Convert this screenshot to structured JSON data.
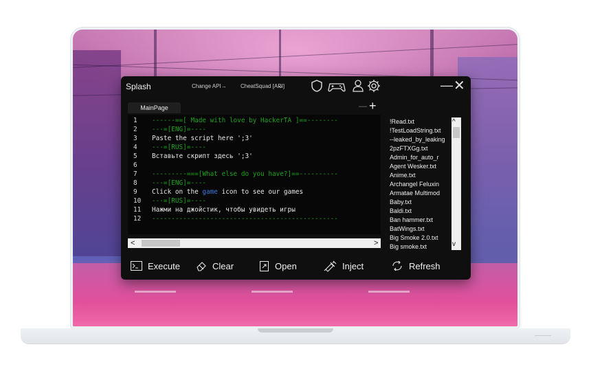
{
  "window": {
    "title": "Splash",
    "change_api_label": "Change API→",
    "api_selected": "CheatSquad [API]",
    "minimize_glyph": "—",
    "close_glyph": "✕"
  },
  "editor": {
    "tab_label": "MainPage",
    "tab_minimize_glyph": "—",
    "tab_add_glyph": "+",
    "lines": [
      {
        "n": "1",
        "text": "------==[ Made with love by HackerTA ]==--------"
      },
      {
        "n": "2",
        "text": "---=[ENG]=----"
      },
      {
        "n": "3",
        "text": "Paste the script here ';3'"
      },
      {
        "n": "4",
        "text": "---=[RUS]=----"
      },
      {
        "n": "5",
        "text": "Вставьте скрипт здесь ';3'"
      },
      {
        "n": "6",
        "text": ""
      },
      {
        "n": "7",
        "text": "---------===[What else do you have?]==----------"
      },
      {
        "n": "8",
        "text": "---=[ENG]=----"
      },
      {
        "n": "9",
        "text_before": "Click on the ",
        "text_highlight": "game",
        "text_after": " icon to see our games"
      },
      {
        "n": "10",
        "text": "---=[RUS]=----"
      },
      {
        "n": "11",
        "text": "Нажми на джойстик, чтобы увидеть игры"
      },
      {
        "n": "12",
        "text": "------------------------------------------------"
      }
    ],
    "scroll_left_glyph": "<",
    "scroll_right_glyph": ">"
  },
  "files": {
    "items": [
      "!Read.txt",
      "!TestLoadString.txt",
      "--leaked_by_leaking",
      "2pzFTXGg.txt",
      "Admin_for_auto_r",
      "Agent Wesker.txt",
      "Anime.txt",
      "Archangel Feluxin",
      "Armatae Multimod",
      "Baby.txt",
      "Baldi.txt",
      "Ban hammer.txt",
      "BatWings.txt",
      "Big Smoke 2.0.txt",
      "Big smoke.txt"
    ],
    "scroll_up_glyph": "^",
    "scroll_down_glyph": "v"
  },
  "actions": {
    "execute": "Execute",
    "clear": "Clear",
    "open": "Open",
    "inject": "Inject",
    "refresh": "Refresh"
  },
  "colors": {
    "window_bg": "#0f0f10",
    "editor_bg": "#070707",
    "comment_green": "#1fa31f",
    "highlight_blue": "#3a7ae0"
  }
}
